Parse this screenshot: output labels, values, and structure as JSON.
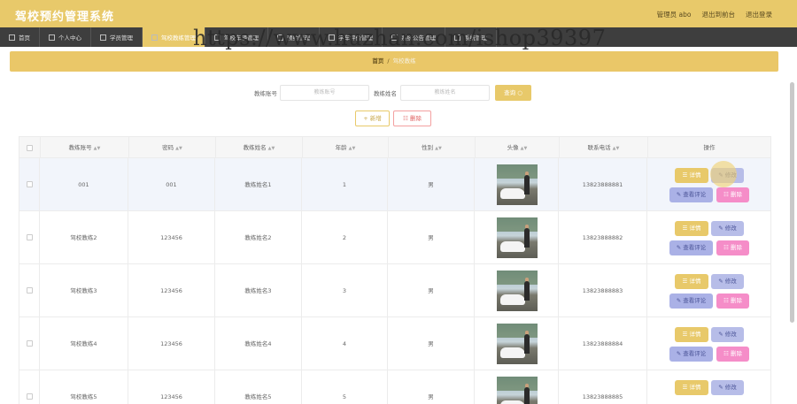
{
  "app": {
    "title": "驾校预约管理系统",
    "user_label": "管理员 abo",
    "frontend_link": "退出到前台",
    "logout_link": "退出登录"
  },
  "nav": [
    {
      "label": "首页",
      "icon": "home-icon"
    },
    {
      "label": "个人中心",
      "icon": "user-icon"
    },
    {
      "label": "学员管理",
      "icon": "student-icon"
    },
    {
      "label": "驾校教练管理",
      "icon": "coach-icon",
      "active": true
    },
    {
      "label": "驾校车辆管理",
      "icon": "car-icon"
    },
    {
      "label": "预约管理",
      "icon": "calendar-icon"
    },
    {
      "label": "学车评价管理",
      "icon": "review-icon"
    },
    {
      "label": "系统公告管理",
      "icon": "notice-icon"
    },
    {
      "label": "系统管理",
      "icon": "settings-icon"
    }
  ],
  "watermark": "https://www.huzhan.com/ishop39397",
  "breadcrumb": {
    "home": "首页",
    "separator": "/",
    "current": "驾校教练"
  },
  "search": {
    "account_label": "教练账号",
    "account_placeholder": "教练账号",
    "name_label": "教练姓名",
    "name_placeholder": "教练姓名",
    "button": "查询"
  },
  "actions": {
    "add": "新增",
    "delete": "删除"
  },
  "table": {
    "headers": [
      "教练账号",
      "密码",
      "教练姓名",
      "年龄",
      "性别",
      "头像",
      "联系电话",
      "操作"
    ],
    "rows": [
      {
        "account": "001",
        "password": "001",
        "name": "教练姓名1",
        "age": "1",
        "gender": "男",
        "phone": "13823888881"
      },
      {
        "account": "驾校教练2",
        "password": "123456",
        "name": "教练姓名2",
        "age": "2",
        "gender": "男",
        "phone": "13823888882"
      },
      {
        "account": "驾校教练3",
        "password": "123456",
        "name": "教练姓名3",
        "age": "3",
        "gender": "男",
        "phone": "13823888883"
      },
      {
        "account": "驾校教练4",
        "password": "123456",
        "name": "教练姓名4",
        "age": "4",
        "gender": "男",
        "phone": "13823888884"
      },
      {
        "account": "驾校教练5",
        "password": "123456",
        "name": "教练姓名5",
        "age": "5",
        "gender": "男",
        "phone": "13823888885"
      }
    ],
    "op_detail": "详情",
    "op_edit": "修改",
    "op_review": "查看评论",
    "op_delete": "删除"
  },
  "colors": {
    "accent": "#e8c96a",
    "navbar": "#3e3e3e",
    "edit": "#b7bde8",
    "delete": "#f58dc8"
  }
}
